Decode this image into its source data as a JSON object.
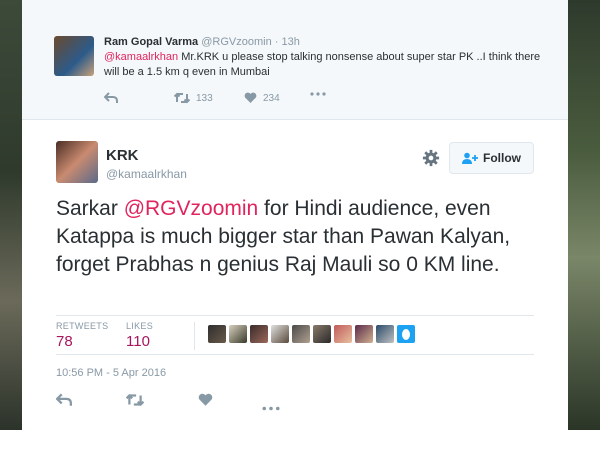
{
  "parent_tweet": {
    "author_name": "Ram Gopal Varma",
    "author_handle": "@RGVzoomin",
    "time": "· 13h",
    "mention": "@kamaalrkhan",
    "text": " Mr.KRK u please stop talking nonsense about super star PK ..I think there will be a 1.5 km q even in Mumbai",
    "retweets": "133",
    "likes": "234"
  },
  "main_tweet": {
    "author_name": "KRK",
    "author_handle": "@kamaalrkhan",
    "follow_label": "Follow",
    "text_before": "Sarkar ",
    "mention": "@RGVzoomin",
    "text_after": " for Hindi audience, even Katappa is much bigger star than Pawan Kalyan, forget Prabhas n genius Raj Mauli so 0 KM line.",
    "retweets_label": "RETWEETS",
    "retweets": "78",
    "likes_label": "LIKES",
    "likes": "110",
    "timestamp": "10:56 PM - 5 Apr 2016"
  },
  "icons": [
    "reply-icon",
    "retweet-icon",
    "heart-icon",
    "more-icon",
    "gear-icon",
    "follow-person-icon"
  ],
  "colors": {
    "mention": "#e0245e",
    "stat_value": "#a6165c",
    "muted": "#8899a6",
    "text": "#292f33"
  }
}
